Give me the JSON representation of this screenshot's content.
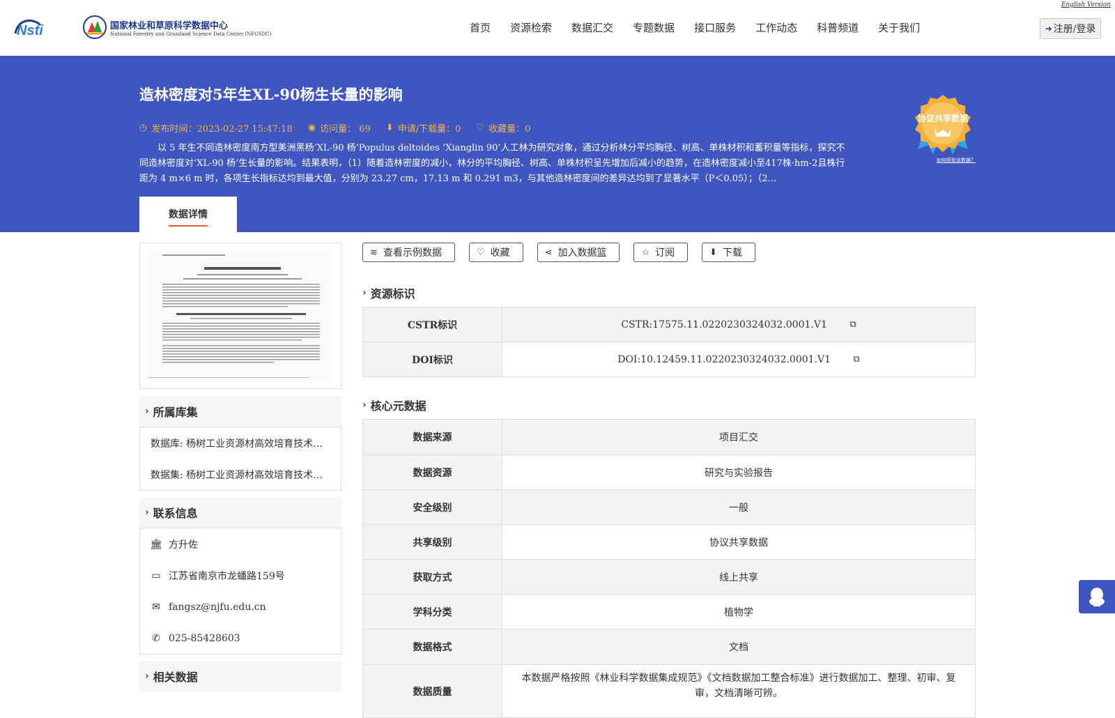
{
  "header": {
    "english_link": "English Version",
    "logo_nsti": "Nsti",
    "logo_cn": "国家林业和草原科学数据中心",
    "logo_en": "National Forestry and Grassland Science Data Center (NFGSDC)",
    "nav": [
      "首页",
      "资源检索",
      "数据汇交",
      "专题数据",
      "接口服务",
      "工作动态",
      "科普频道",
      "关于我们"
    ],
    "login": "注册/登录"
  },
  "banner": {
    "title": "造林密度对5年生XL-90杨生长量的影响",
    "publish_time": "发布时间：2023-02-27 15:47:18",
    "visits": "访问量： 69",
    "downloads": "申请/下载量：0",
    "favorites": "收藏量：0",
    "abstract": "以 5 年生不同造林密度南方型美洲黑杨‘XL-90 杨’Populus deltoides ‘Xianglin 90’人工林为研究对象，通过分析林分平均胸径、树高、单株材积和蓄积量等指标，探究不同造林密度对‘XL-90 杨’生长量的影响。结果表明，（1）随着造林密度的减小，林分的平均胸径、树高、单株材积呈先增加后减小的趋势，在造林密度减小至417株·hm-2且株行距为 4 m×6 m 时，各项生长指标达均到最大值，分别为 23.27 cm，17.13 m 和 0.291 m3，与其他造林密度间的差异达均到了显著水平（P＜0.05）；（2…",
    "badge_text": "协议共享数据",
    "badge_link": "如何获取该数据？",
    "tab": "数据详情"
  },
  "left": {
    "collection_title": "所属库集",
    "collections": [
      "数据库: 杨树工业资源材高效培育技术…",
      "数据集: 杨树工业资源材高效培育技术…"
    ],
    "contact_title": "联系信息",
    "contact_name": "方升佐",
    "contact_address": "江苏省南京市龙蟠路159号",
    "contact_email": "fangsz@njfu.edu.cn",
    "contact_phone": "025-85428603",
    "related_title": "相关数据"
  },
  "actions": [
    "查看示例数据",
    "收藏",
    "加入数据篮",
    "订阅",
    "下载"
  ],
  "resource_id": {
    "title": "资源标识",
    "rows": [
      {
        "k": "CSTR标识",
        "v": "CSTR:17575.11.0220230324032.0001.V1"
      },
      {
        "k": "DOI标识",
        "v": "DOI:10.12459.11.0220230324032.0001.V1"
      }
    ]
  },
  "core_meta": {
    "title": "核心元数据",
    "rows": [
      {
        "k": "数据来源",
        "v": "项目汇交"
      },
      {
        "k": "数据资源",
        "v": "研究与实验报告"
      },
      {
        "k": "安全级别",
        "v": "一般"
      },
      {
        "k": "共享级别",
        "v": "协议共享数据"
      },
      {
        "k": "获取方式",
        "v": "线上共享"
      },
      {
        "k": "学科分类",
        "v": "植物学"
      },
      {
        "k": "数据格式",
        "v": "文档"
      },
      {
        "k": "数据质量",
        "v": "本数据严格按照《林业科学数据集成规范》《文档数据加工整合标准》进行数据加工、整理、初审、复审，文档清晰可辨。"
      }
    ]
  },
  "colors": {
    "banner": "#3f56c0",
    "accent": "#f5b53c",
    "brand": "#1c3b8f"
  }
}
